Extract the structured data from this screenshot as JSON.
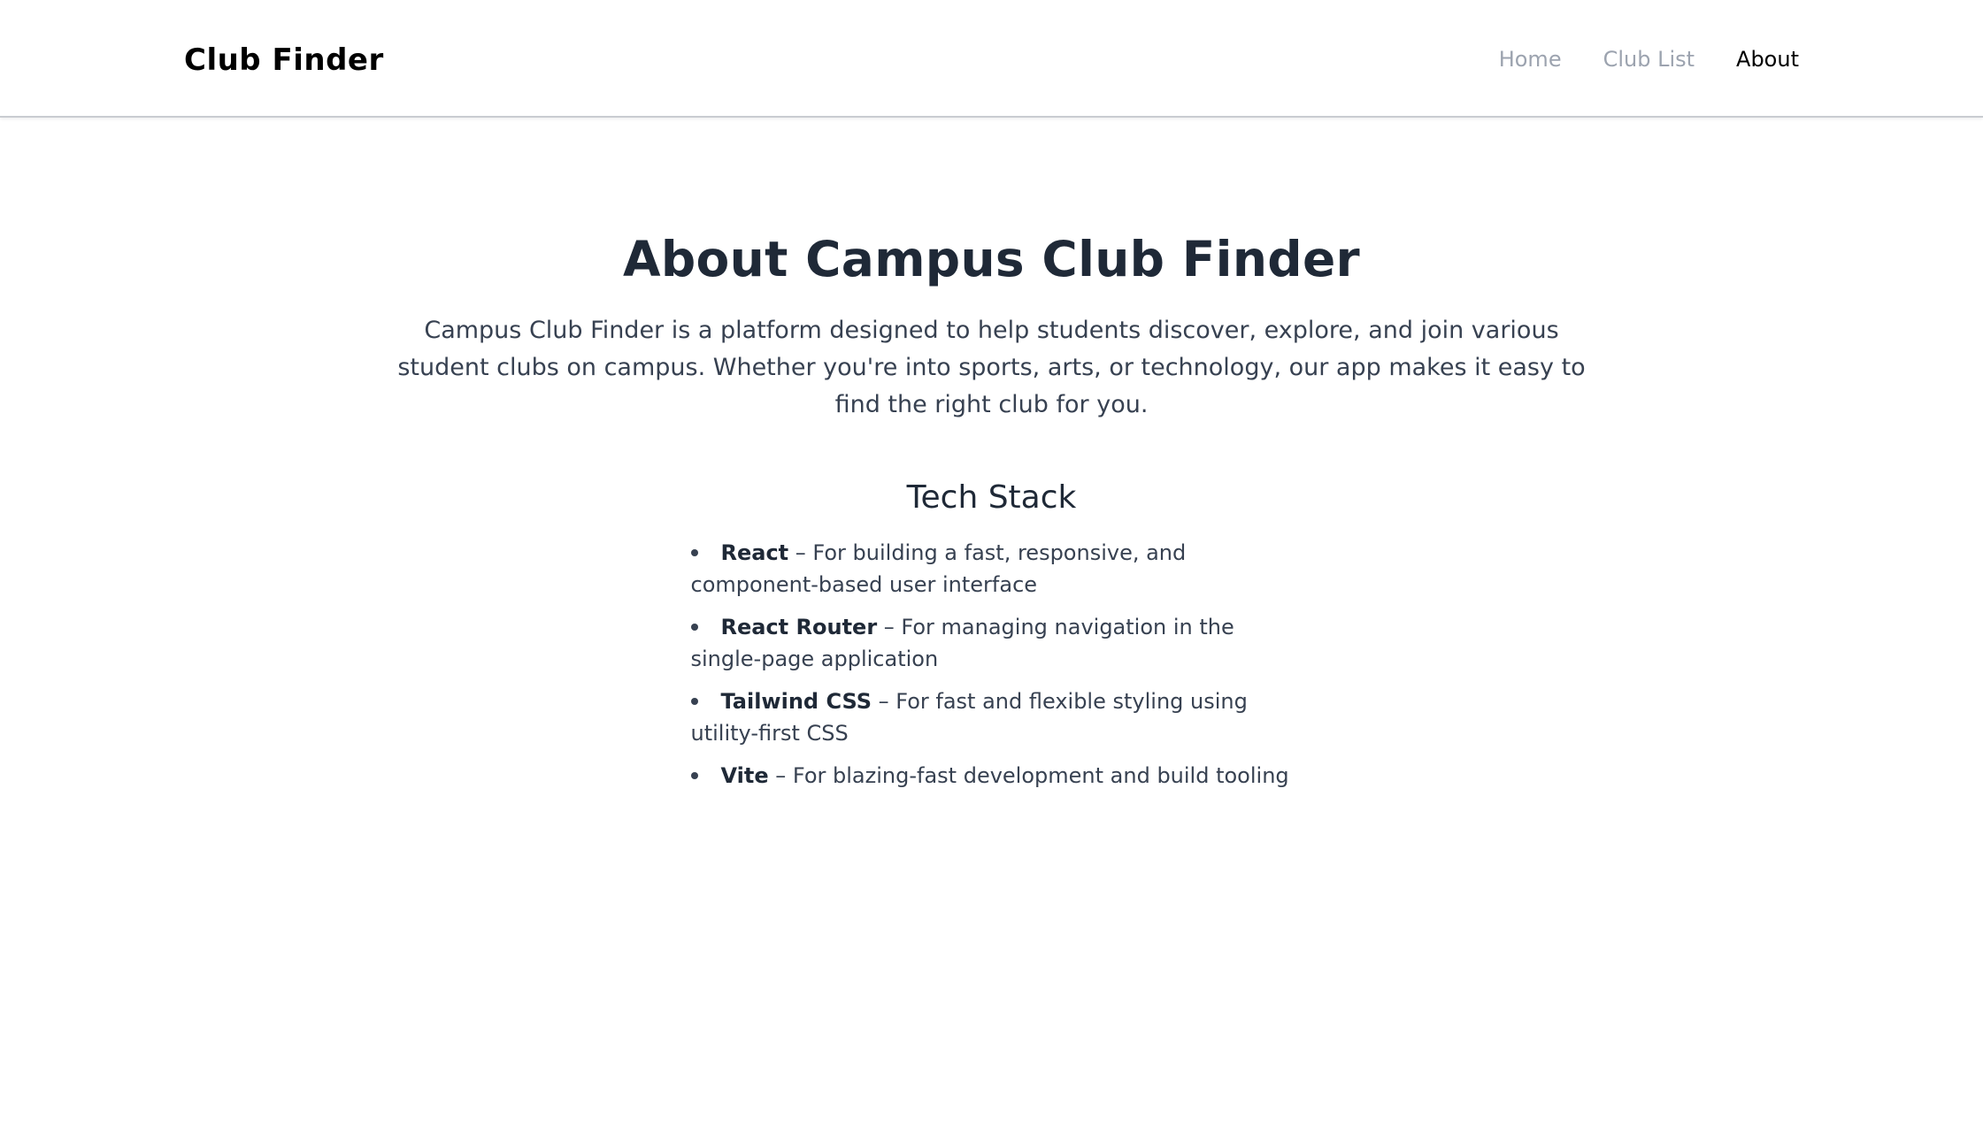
{
  "nav": {
    "brand": "Club Finder",
    "links": [
      {
        "label": "Home"
      },
      {
        "label": "Club List"
      },
      {
        "label": "About"
      }
    ]
  },
  "about": {
    "title": "About Campus Club Finder",
    "intro": "Campus Club Finder is a platform designed to help students discover, explore, and join various student clubs on campus. Whether you're into sports, arts, or technology, our app makes it easy to find the right club for you.",
    "tech_stack_title": "Tech Stack",
    "tech_stack": [
      {
        "name": "React",
        "description": " – For building a fast, responsive, and component-based user interface"
      },
      {
        "name": "React Router",
        "description": " – For managing navigation in the single-page application"
      },
      {
        "name": "Tailwind CSS",
        "description": " – For fast and flexible styling using utility-first CSS"
      },
      {
        "name": "Vite",
        "description": " – For blazing-fast development and build tooling"
      }
    ]
  },
  "colors": {
    "text_dark": "#1f2937",
    "text_body": "#374151",
    "nav_inactive": "#9ca3af",
    "nav_active": "#000000"
  }
}
